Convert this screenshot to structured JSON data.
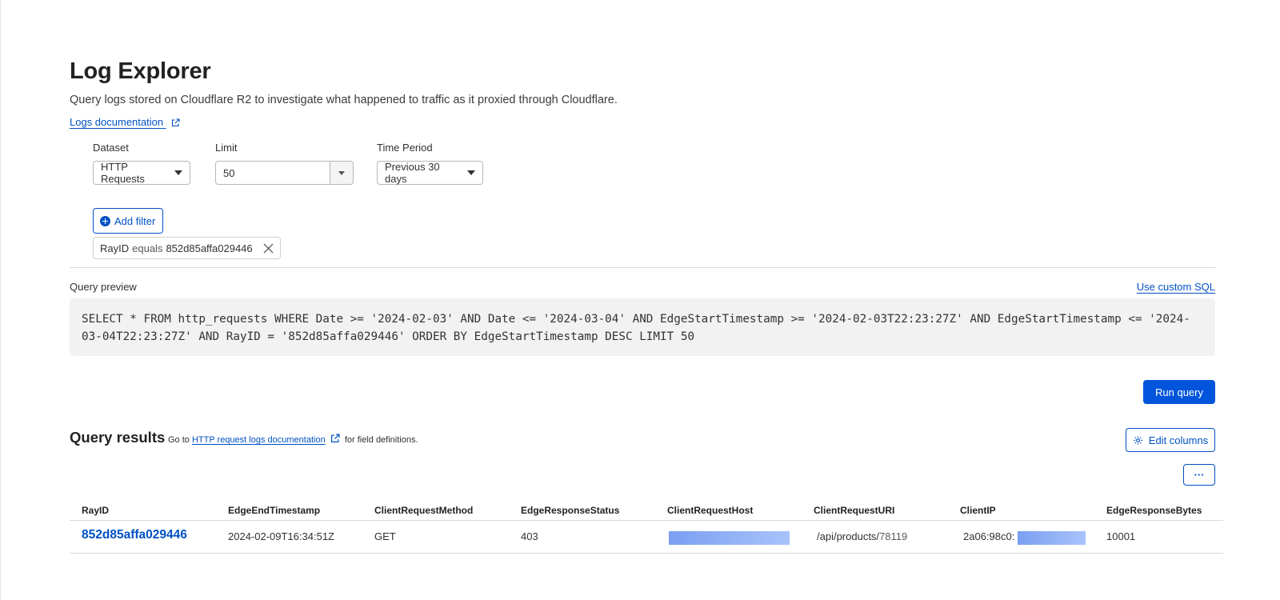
{
  "header": {
    "title": "Log Explorer",
    "subtitle": "Query logs stored on Cloudflare R2 to investigate what happened to traffic as it proxied through Cloudflare.",
    "docs_link": "Logs documentation"
  },
  "controls": {
    "dataset": {
      "label": "Dataset",
      "value": "HTTP Requests"
    },
    "limit": {
      "label": "Limit",
      "value": "50"
    },
    "time_period": {
      "label": "Time Period",
      "value": "Previous 30 days"
    }
  },
  "filters": {
    "add_label": "Add filter",
    "active": [
      {
        "field": "RayID",
        "operator": "equals",
        "value": "852d85affa029446"
      }
    ]
  },
  "query_preview": {
    "label": "Query preview",
    "custom_sql_link": "Use custom SQL",
    "sql": "SELECT * FROM http_requests WHERE Date >= '2024-02-03' AND Date <= '2024-03-04' AND EdgeStartTimestamp >= '2024-02-03T22:23:27Z' AND EdgeStartTimestamp <= '2024-03-04T22:23:27Z' AND RayID = '852d85affa029446' ORDER BY EdgeStartTimestamp DESC LIMIT 50",
    "run_label": "Run query"
  },
  "results": {
    "title": "Query results",
    "help_prefix": "Go to",
    "help_link": "HTTP request logs documentation",
    "help_suffix": "for field definitions.",
    "edit_columns_label": "Edit columns",
    "more_label": "···",
    "columns": [
      "RayID",
      "EdgeEndTimestamp",
      "ClientRequestMethod",
      "EdgeResponseStatus",
      "ClientRequestHost",
      "ClientRequestURI",
      "ClientIP",
      "EdgeResponseBytes"
    ],
    "rows": [
      {
        "ray_id": "852d85affa029446",
        "edge_end_timestamp": "2024-02-09T16:34:51Z",
        "method": "GET",
        "status": "403",
        "uri_path": "/api/products/",
        "uri_id": "78119",
        "client_ip_prefix": "2a06:98c0:",
        "bytes": "10001"
      }
    ]
  },
  "colors": {
    "link": "#0051c3",
    "primary_button": "#0055dc",
    "query_bg": "#f2f2f2",
    "redaction": "#7a9ff2"
  },
  "icons": [
    "external-link-icon",
    "caret-down-icon",
    "plus-circle-icon",
    "close-icon",
    "gear-icon"
  ]
}
